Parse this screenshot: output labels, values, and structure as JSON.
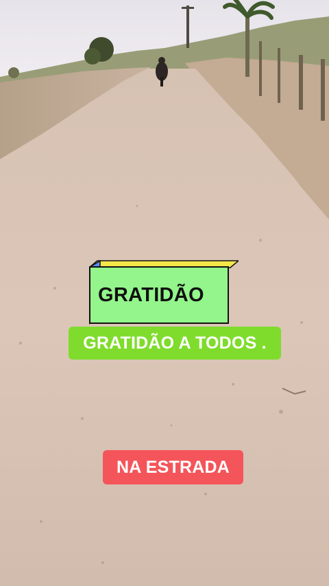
{
  "overlay": {
    "box_label": "GRATIDÃO",
    "caption_green": "GRATIDÃO A TODOS .",
    "caption_red": "NA ESTRADA"
  },
  "colors": {
    "box_front": "#93f58b",
    "box_top": "#f5e64a",
    "box_side": "#5b8cf0",
    "caption_green_bg": "#7fdc2c",
    "caption_red_bg": "#f4555a"
  }
}
